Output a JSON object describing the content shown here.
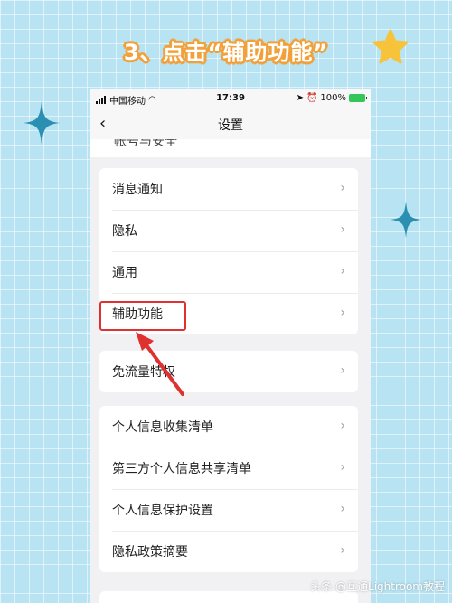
{
  "headline": "3、点击“辅助功能”",
  "status_bar": {
    "carrier": "中国移动",
    "time": "17:39",
    "battery": "100%"
  },
  "nav": {
    "back_icon": "chevron-left-icon",
    "title": "设置"
  },
  "partial_item": "帐号与安全",
  "groups": [
    {
      "items": [
        "消息通知",
        "隐私",
        "通用",
        "辅助功能"
      ]
    },
    {
      "items": [
        "免流量特权"
      ]
    },
    {
      "items": [
        "个人信息收集清单",
        "第三方个人信息共享清单",
        "个人信息保护设置",
        "隐私政策摘要"
      ]
    }
  ],
  "highlighted_item": "辅助功能",
  "watermark": "头条 @互通Lightroom教程",
  "colors": {
    "background": "#b7e3f2",
    "headline_outline": "#f2a13a",
    "highlight_red": "#e03131",
    "star_yellow": "#f6c33b",
    "sparkle_blue": "#2a8fb0"
  }
}
